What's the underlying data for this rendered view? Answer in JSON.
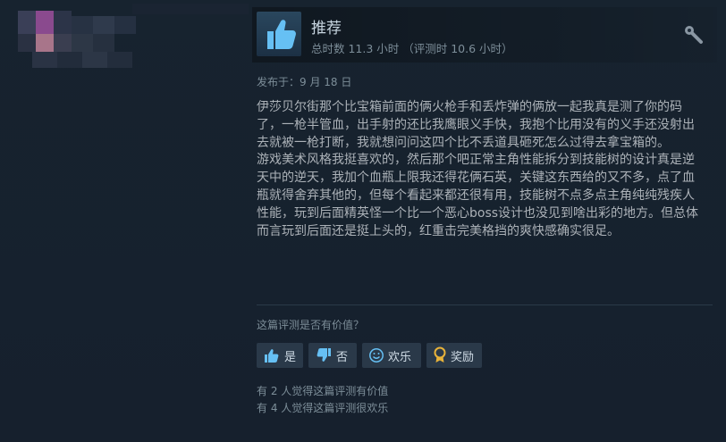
{
  "review": {
    "verdict": "推荐",
    "hours": "总时数 11.3 小时 （评测时 10.6 小时）",
    "posted": "发布于：9 月 18 日",
    "paragraphs": [
      "伊莎贝尔街那个比宝箱前面的俩火枪手和丢炸弹的俩放一起我真是测了你的码了，一枪半管血，出手射的还比我鹰眼义手快，我抱个比用没有的义手还没射出去就被一枪打断，我就想问问这四个比不丢道具砸死怎么过得去拿宝箱的。",
      "游戏美术风格我挺喜欢的，然后那个吧正常主角性能拆分到技能树的设计真是逆天中的逆天，我加个血瓶上限我还得花俩石英，关键这东西给的又不多，点了血瓶就得舍弃其他的，但每个看起来都还很有用，技能树不点多点主角纯纯残疾人性能，玩到后面精英怪一个比一个恶心boss设计也没见到啥出彩的地方。但总体而言玩到后面还是挺上头的，红重击完美格挡的爽快感确实很足。"
    ]
  },
  "helpful": {
    "question": "这篇评测是否有价值？",
    "yes_label": "是",
    "no_label": "否",
    "funny_label": "欢乐",
    "award_label": "奖励",
    "helpful_count": "有 2 人觉得这篇评测有价值",
    "funny_count": "有 4 人觉得这篇评测很欢乐"
  },
  "colors": {
    "background": "#1b2838",
    "thumb_accent": "#66c0f4",
    "award_gold": "#e8b33a",
    "button_bg": "#2a3949"
  },
  "icons": [
    "thumbs-up-icon",
    "thumbs-down-icon",
    "smiley-icon",
    "award-icon",
    "wrench-settings-icon"
  ]
}
